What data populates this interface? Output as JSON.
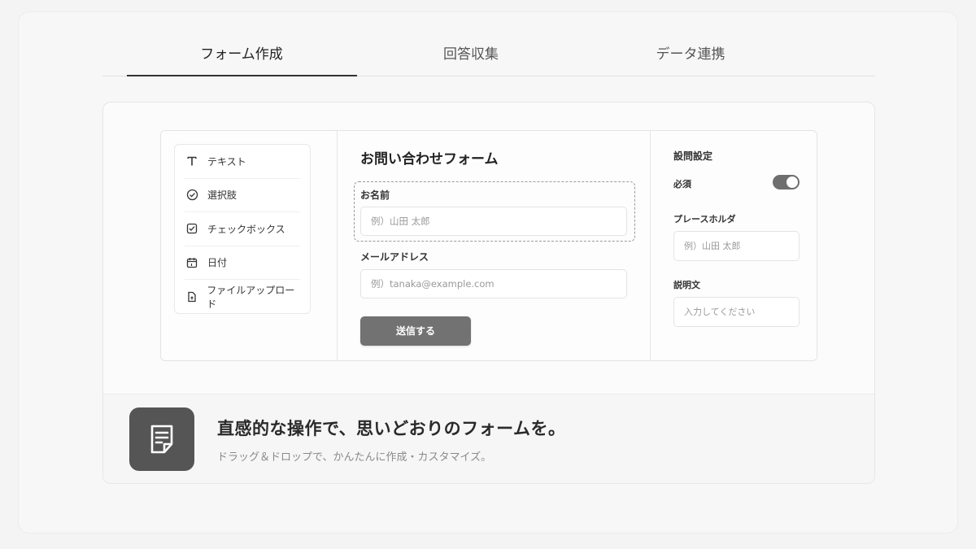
{
  "tabs": [
    {
      "label": "フォーム作成",
      "active": true
    },
    {
      "label": "回答収集",
      "active": false
    },
    {
      "label": "データ連携",
      "active": false
    }
  ],
  "palette": {
    "items": [
      {
        "label": "テキスト",
        "icon": "text-icon"
      },
      {
        "label": "選択肢",
        "icon": "check-circle-icon"
      },
      {
        "label": "チェックボックス",
        "icon": "checkbox-icon"
      },
      {
        "label": "日付",
        "icon": "calendar-icon"
      },
      {
        "label": "ファイルアップロード",
        "icon": "file-upload-icon"
      }
    ]
  },
  "form": {
    "title": "お問い合わせフォーム",
    "name_label": "お名前",
    "name_placeholder": "例）山田 太郎",
    "email_label": "メールアドレス",
    "email_placeholder": "例）tanaka@example.com",
    "submit_label": "送信する"
  },
  "settings": {
    "title": "設問設定",
    "required_label": "必須",
    "required_on": true,
    "placeholder_label": "プレースホルダ",
    "placeholder_value": "例）山田 太郎",
    "description_label": "説明文",
    "description_placeholder": "入力してください"
  },
  "banner": {
    "headline": "直感的な操作で、思いどおりのフォームを。",
    "subline": "ドラッグ＆ドロップで、かんたんに作成・カスタマイズ。",
    "icon": "document-icon"
  },
  "colors": {
    "accent": "#727272",
    "icon_bg": "#555555"
  }
}
